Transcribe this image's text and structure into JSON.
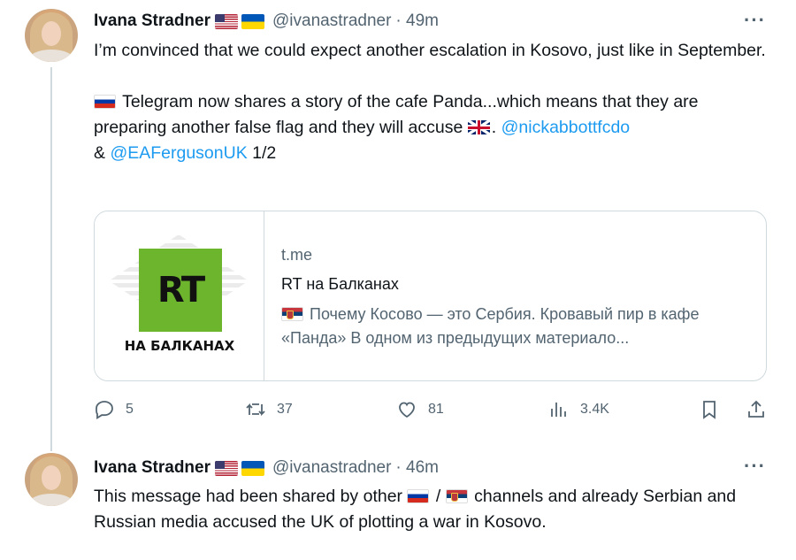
{
  "tweets": [
    {
      "author": "Ivana Stradner",
      "handle": "@ivanastradner",
      "time": "· 49m",
      "text": {
        "line1": "I’m convinced that we could expect another escalation in Kosovo, just like in September.",
        "line2_part1": " Telegram now shares a story of the cafe Panda...which means that they are preparing another false flag and they will accuse ",
        "line2_part2": ". ",
        "mention1": "@nickabbottfcdo",
        "line2_part3": "& ",
        "mention2": "@EAFergusonUK",
        "line2_part4": " 1/2"
      },
      "card": {
        "thumb_logo": "RT",
        "thumb_caption": "НА БАЛКАНАХ",
        "domain": "t.me",
        "title": "RT на Балканах",
        "description": " Почему Косово — это Сербия. Кровавый пир в кафе «Панда» В одном из предыдущих материало..."
      },
      "actions": {
        "replies": "5",
        "retweets": "37",
        "likes": "81",
        "views": "3.4K"
      }
    },
    {
      "author": "Ivana Stradner",
      "handle": "@ivanastradner",
      "time": "· 46m",
      "text": {
        "part1": "This message had been shared by other ",
        "sep": " / ",
        "part2": " channels and already Serbian and Russian media accused the UK of plotting a war in Kosovo."
      }
    }
  ],
  "icons": {
    "more": "more-horizontal-icon",
    "reply": "reply-icon",
    "retweet": "retweet-icon",
    "like": "heart-icon",
    "views": "views-icon",
    "bookmark": "bookmark-icon",
    "share": "share-icon"
  },
  "colors": {
    "link": "#1d9bf0",
    "muted": "#536471",
    "text": "#0f1419",
    "border": "#cfd9de",
    "rt_green": "#6cb52d"
  }
}
